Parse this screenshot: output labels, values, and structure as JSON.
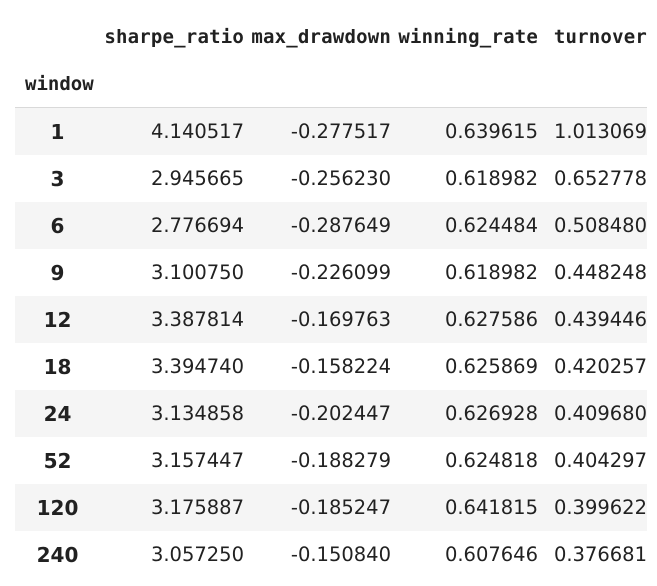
{
  "table": {
    "index_name": "window",
    "columns": [
      "sharpe_ratio",
      "max_drawdown",
      "winning_rate",
      "turnover"
    ],
    "rows": [
      {
        "index": "1",
        "values": [
          "4.140517",
          "-0.277517",
          "0.639615",
          "1.013069"
        ]
      },
      {
        "index": "3",
        "values": [
          "2.945665",
          "-0.256230",
          "0.618982",
          "0.652778"
        ]
      },
      {
        "index": "6",
        "values": [
          "2.776694",
          "-0.287649",
          "0.624484",
          "0.508480"
        ]
      },
      {
        "index": "9",
        "values": [
          "3.100750",
          "-0.226099",
          "0.618982",
          "0.448248"
        ]
      },
      {
        "index": "12",
        "values": [
          "3.387814",
          "-0.169763",
          "0.627586",
          "0.439446"
        ]
      },
      {
        "index": "18",
        "values": [
          "3.394740",
          "-0.158224",
          "0.625869",
          "0.420257"
        ]
      },
      {
        "index": "24",
        "values": [
          "3.134858",
          "-0.202447",
          "0.626928",
          "0.409680"
        ]
      },
      {
        "index": "52",
        "values": [
          "3.157447",
          "-0.188279",
          "0.624818",
          "0.404297"
        ]
      },
      {
        "index": "120",
        "values": [
          "3.175887",
          "-0.185247",
          "0.641815",
          "0.399622"
        ]
      },
      {
        "index": "240",
        "values": [
          "3.057250",
          "-0.150840",
          "0.607646",
          "0.376681"
        ]
      }
    ]
  },
  "colors": {
    "row_stripe": "#f5f5f5",
    "row_plain": "#ffffff",
    "header_rule": "#d9d9d9",
    "text": "#212121"
  }
}
